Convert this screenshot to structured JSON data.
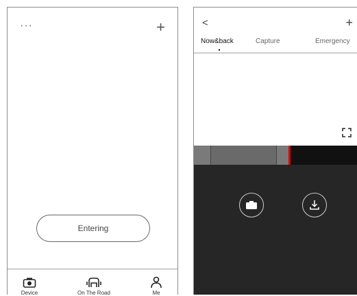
{
  "left_screen": {
    "header": {
      "more": "···",
      "add": "+"
    },
    "entering_button": "Entering",
    "tabbar": [
      {
        "label": "Device",
        "icon": "camera-device-icon"
      },
      {
        "label": "On The Road",
        "icon": "car-seat-icon"
      },
      {
        "label": "Me",
        "icon": "person-icon"
      }
    ]
  },
  "right_screen": {
    "header": {
      "back": "<",
      "add": "+"
    },
    "tabs": [
      "Now&back",
      "Capture",
      "Emergency"
    ],
    "active_tab": 0,
    "icons": {
      "fullscreen": "fullscreen-icon",
      "capture": "camera-icon",
      "download": "download-icon"
    },
    "timeline": {
      "marker_color": "#e00000"
    }
  }
}
